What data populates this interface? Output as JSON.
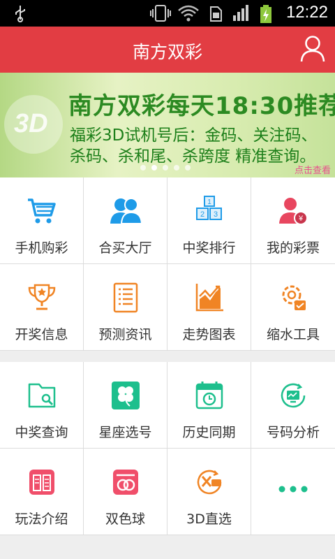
{
  "statusbar": {
    "time": "12:22"
  },
  "header": {
    "title": "南方双彩"
  },
  "banner": {
    "headline": "南方双彩每天18:30推荐",
    "line1": "福彩3D试机号后：金码、关注码、",
    "line2": "杀码、杀和尾、杀跨度 精准查询。",
    "more": "点击查看",
    "logo_text": "3D"
  },
  "grid1": [
    {
      "label": "手机购彩",
      "icon": "shopping-cart-icon"
    },
    {
      "label": "合买大厅",
      "icon": "group-users-icon"
    },
    {
      "label": "中奖排行",
      "icon": "ranking-blocks-icon"
    },
    {
      "label": "我的彩票",
      "icon": "user-ticket-icon"
    },
    {
      "label": "开奖信息",
      "icon": "trophy-icon"
    },
    {
      "label": "预测资讯",
      "icon": "document-list-icon"
    },
    {
      "label": "走势图表",
      "icon": "trend-chart-icon"
    },
    {
      "label": "缩水工具",
      "icon": "gear-tools-icon"
    }
  ],
  "grid2": [
    {
      "label": "中奖查询",
      "icon": "folder-search-icon"
    },
    {
      "label": "星座选号",
      "icon": "clover-icon"
    },
    {
      "label": "历史同期",
      "icon": "calendar-clock-icon"
    },
    {
      "label": "号码分析",
      "icon": "analysis-monitor-icon"
    },
    {
      "label": "玩法介绍",
      "icon": "book-icon"
    },
    {
      "label": "双色球",
      "icon": "double-ball-icon"
    },
    {
      "label": "3D直选",
      "icon": "3d-direct-icon"
    },
    {
      "label": "",
      "icon": "more-dots-icon"
    }
  ],
  "colors": {
    "header": "#e23d43",
    "accent_blue": "#1e9be8",
    "accent_orange": "#f08424",
    "accent_green": "#1dbf8d",
    "accent_pink": "#f04e6a"
  }
}
